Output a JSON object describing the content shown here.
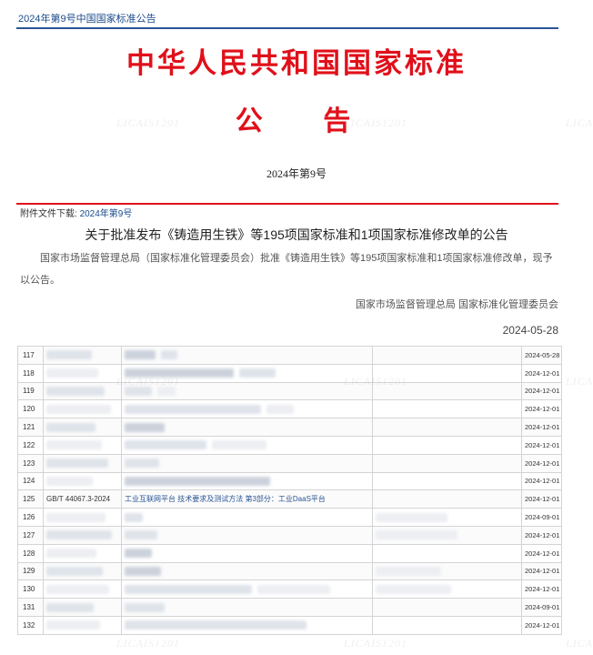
{
  "header": {
    "breadcrumb": "2024年第9号中国国家标准公告"
  },
  "document": {
    "title": "中华人民共和国国家标准",
    "subtitle": "公 告",
    "issue_no": "2024年第9号",
    "attachment_label": "附件文件下载:",
    "attachment_link": "2024年第9号",
    "notice_title": "关于批准发布《铸造用生铁》等195项国家标准和1项国家标准修改单的公告",
    "notice_body": "国家市场监督管理总局（国家标准化管理委员会）批准《铸造用生铁》等195项国家标准和1项国家标准修改单，现予以公告。",
    "signer": "国家市场监督管理总局 国家标准化管理委员会",
    "sign_date": "2024-05-28"
  },
  "table": {
    "rows": [
      {
        "no": "117",
        "code": "",
        "name": "",
        "date": "2024-05-28"
      },
      {
        "no": "118",
        "code": "",
        "name": "",
        "date": "2024-12-01"
      },
      {
        "no": "119",
        "code": "",
        "name": "",
        "date": "2024-12-01"
      },
      {
        "no": "120",
        "code": "",
        "name": "",
        "date": "2024-12-01"
      },
      {
        "no": "121",
        "code": "",
        "name": "",
        "date": "2024-12-01"
      },
      {
        "no": "122",
        "code": "",
        "name": "",
        "date": "2024-12-01"
      },
      {
        "no": "123",
        "code": "",
        "name": "",
        "date": "2024-12-01"
      },
      {
        "no": "124",
        "code": "",
        "name": "",
        "date": "2024-12-01"
      },
      {
        "no": "125",
        "code": "GB/T 44067.3-2024",
        "name": "工业互联网平台 技术要求及测试方法 第3部分：工业DaaS平台",
        "date": "2024-12-01"
      },
      {
        "no": "126",
        "code": "",
        "name": "",
        "date": "2024-09-01"
      },
      {
        "no": "127",
        "code": "",
        "name": "",
        "date": "2024-12-01"
      },
      {
        "no": "128",
        "code": "",
        "name": "",
        "date": "2024-12-01"
      },
      {
        "no": "129",
        "code": "",
        "name": "",
        "date": "2024-12-01"
      },
      {
        "no": "130",
        "code": "",
        "name": "",
        "date": "2024-12-01"
      },
      {
        "no": "131",
        "code": "",
        "name": "",
        "date": "2024-09-01"
      },
      {
        "no": "132",
        "code": "",
        "name": "",
        "date": "2024-12-01"
      }
    ]
  },
  "watermark": "LICAIS1201"
}
